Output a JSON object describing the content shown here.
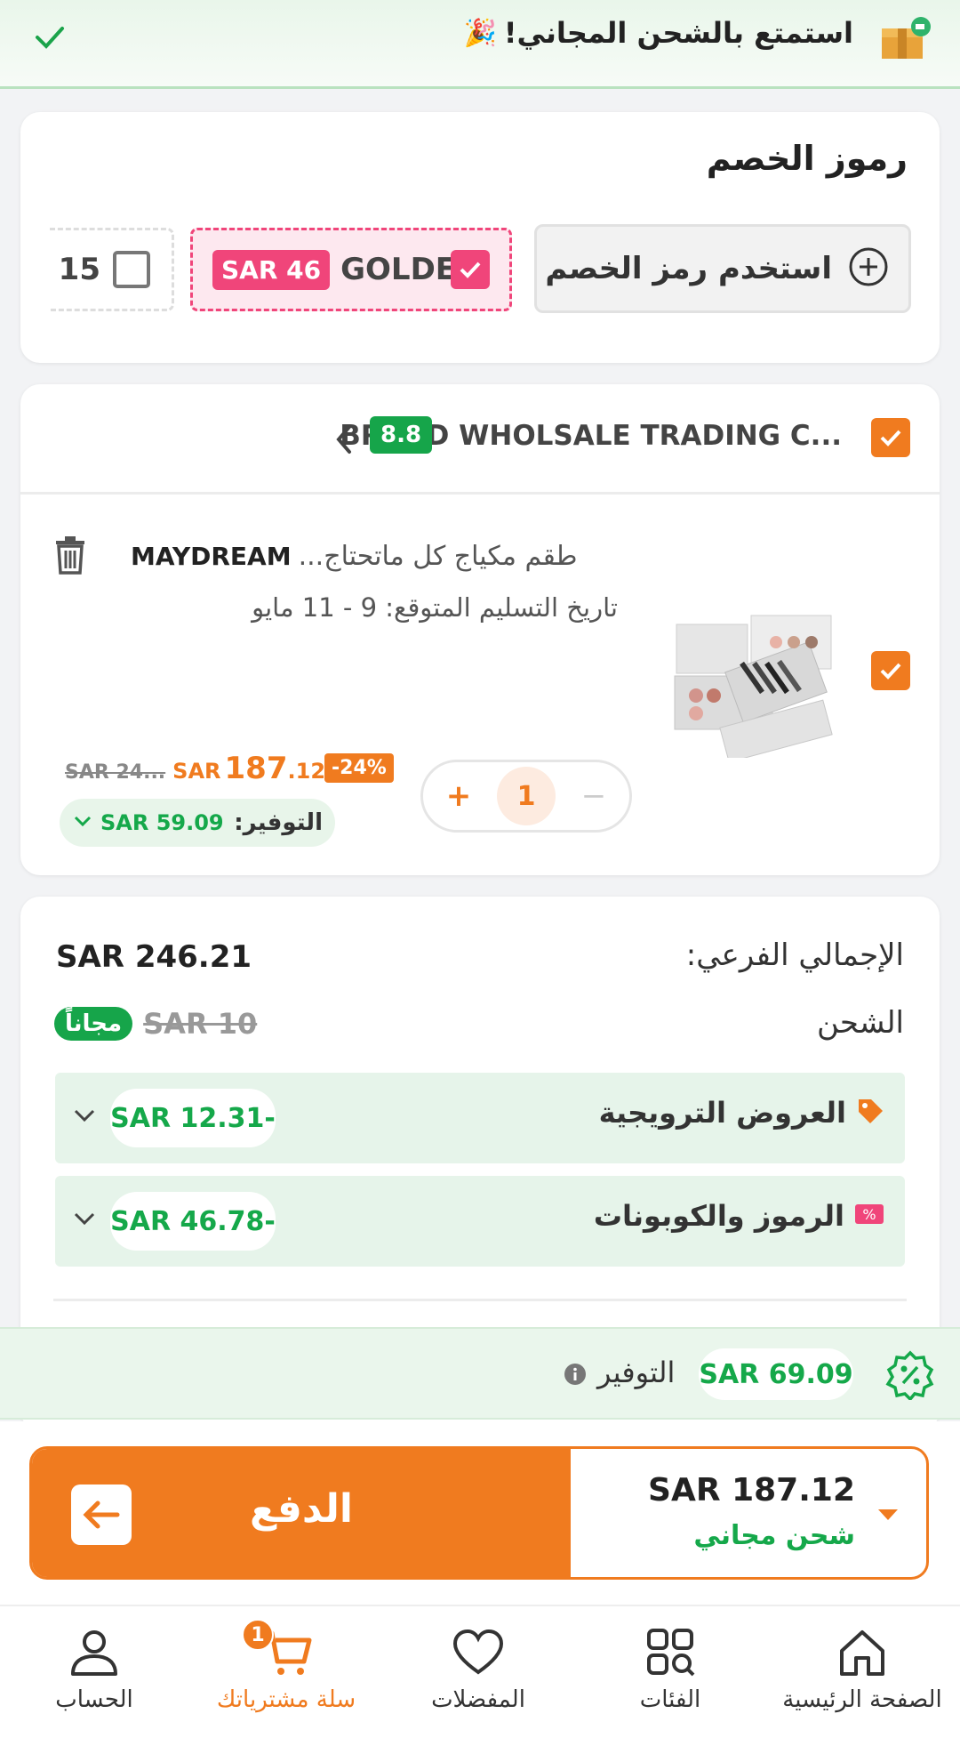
{
  "banner": {
    "text": "استمتع بالشحن المجاني!",
    "party_emoji": "🎉"
  },
  "coupons": {
    "title": "رموز الخصم",
    "use_code_label": "استخدم رمز الخصم",
    "selected_code": "GOLDE",
    "selected_amount": "SAR 46",
    "other_code": "15"
  },
  "seller": {
    "name": "BRAND WHOLSALE TRADING C...",
    "rating": "8.8"
  },
  "product": {
    "title": "طقم مكياج كل ماتحتاج...",
    "brand": "MAYDREAM",
    "delivery": "تاريخ التسليم المتوقع: 9 - 11 مايو",
    "old_price": "SAR 24...",
    "currency": "SAR",
    "price_main": "187",
    "price_decimal": ".12",
    "discount": "-24%",
    "quantity": "1",
    "plus": "+",
    "minus": "−",
    "savings_label": "التوفير:",
    "savings_value": "SAR 59.09"
  },
  "summary": {
    "subtotal_label": "الإجمالي الفرعي:",
    "subtotal_value": "SAR 246.21",
    "shipping_label": "الشحن",
    "shipping_old": "SAR 10",
    "shipping_free": "مجاناً",
    "promo_label": "العروض الترويجية",
    "promo_value": "SAR 12.31-",
    "coupons_label": "الرموز والكوبونات",
    "coupons_value": "SAR 46.78-"
  },
  "savings_bar": {
    "value": "SAR 69.09",
    "label": "التوفير"
  },
  "checkout": {
    "total": "SAR 187.12",
    "shipping_note": "شحن مجاني",
    "pay_label": "الدفع"
  },
  "nav": {
    "home": "الصفحة الرئيسية",
    "categories": "الفئات",
    "favorites": "المفضلات",
    "cart": "سلة مشترياتك",
    "cart_badge": "1",
    "account": "الحساب"
  },
  "colors": {
    "accent": "#f07b1f",
    "green": "#15a84a",
    "pink": "#f0457a"
  }
}
